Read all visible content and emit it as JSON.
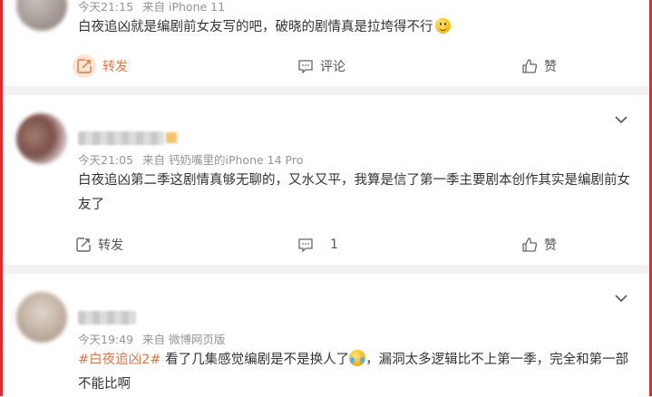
{
  "comments": [
    {
      "time": "今天21:15",
      "source": "来自 iPhone 11",
      "text": "白夜追凶就是编剧前女友写的吧，破晓的剧情真是拉垮得不行",
      "repost_label": "转发",
      "comment_label": "评论",
      "like_label": "赞"
    },
    {
      "time": "今天21:05",
      "source": "来自 钙奶嘴里的iPhone 14 Pro",
      "text": "白夜追凶第二季这剧情真够无聊的，又水又平，我算是信了第一季主要剧本创作其实是编剧前女友了",
      "repost_label": "转发",
      "comment_count": "1",
      "like_label": "赞"
    },
    {
      "time": "今天19:49",
      "source": "来自 微博网页版",
      "topic": "#白夜追凶2#",
      "text_before": " 看了几集感觉编剧是不是换人了",
      "text_after": "，漏洞太多逻辑比不上第一季，完全和第一部不能比啊"
    }
  ],
  "colors": {
    "accent": "#eb7340",
    "frame": "#e02b2b",
    "meta": "#939393",
    "text": "#333333"
  }
}
